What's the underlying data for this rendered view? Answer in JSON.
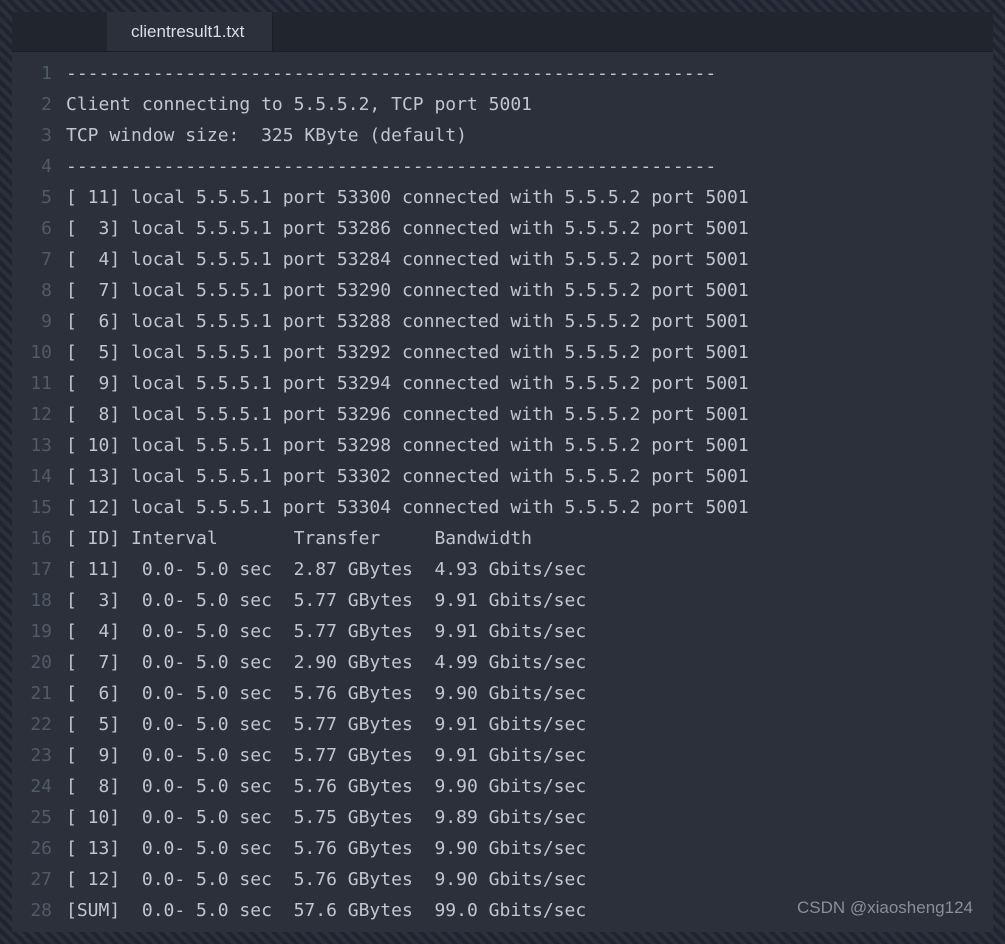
{
  "tab": {
    "filename": "clientresult1.txt"
  },
  "watermark": "CSDN @xiaosheng124",
  "lines": [
    "------------------------------------------------------------",
    "Client connecting to 5.5.5.2, TCP port 5001",
    "TCP window size:  325 KByte (default)",
    "------------------------------------------------------------",
    "[ 11] local 5.5.5.1 port 53300 connected with 5.5.5.2 port 5001",
    "[  3] local 5.5.5.1 port 53286 connected with 5.5.5.2 port 5001",
    "[  4] local 5.5.5.1 port 53284 connected with 5.5.5.2 port 5001",
    "[  7] local 5.5.5.1 port 53290 connected with 5.5.5.2 port 5001",
    "[  6] local 5.5.5.1 port 53288 connected with 5.5.5.2 port 5001",
    "[  5] local 5.5.5.1 port 53292 connected with 5.5.5.2 port 5001",
    "[  9] local 5.5.5.1 port 53294 connected with 5.5.5.2 port 5001",
    "[  8] local 5.5.5.1 port 53296 connected with 5.5.5.2 port 5001",
    "[ 10] local 5.5.5.1 port 53298 connected with 5.5.5.2 port 5001",
    "[ 13] local 5.5.5.1 port 53302 connected with 5.5.5.2 port 5001",
    "[ 12] local 5.5.5.1 port 53304 connected with 5.5.5.2 port 5001",
    "[ ID] Interval       Transfer     Bandwidth",
    "[ 11]  0.0- 5.0 sec  2.87 GBytes  4.93 Gbits/sec",
    "[  3]  0.0- 5.0 sec  5.77 GBytes  9.91 Gbits/sec",
    "[  4]  0.0- 5.0 sec  5.77 GBytes  9.91 Gbits/sec",
    "[  7]  0.0- 5.0 sec  2.90 GBytes  4.99 Gbits/sec",
    "[  6]  0.0- 5.0 sec  5.76 GBytes  9.90 Gbits/sec",
    "[  5]  0.0- 5.0 sec  5.77 GBytes  9.91 Gbits/sec",
    "[  9]  0.0- 5.0 sec  5.77 GBytes  9.91 Gbits/sec",
    "[  8]  0.0- 5.0 sec  5.76 GBytes  9.90 Gbits/sec",
    "[ 10]  0.0- 5.0 sec  5.75 GBytes  9.89 Gbits/sec",
    "[ 13]  0.0- 5.0 sec  5.76 GBytes  9.90 Gbits/sec",
    "[ 12]  0.0- 5.0 sec  5.76 GBytes  9.90 Gbits/sec",
    "[SUM]  0.0- 5.0 sec  57.6 GBytes  99.0 Gbits/sec"
  ]
}
